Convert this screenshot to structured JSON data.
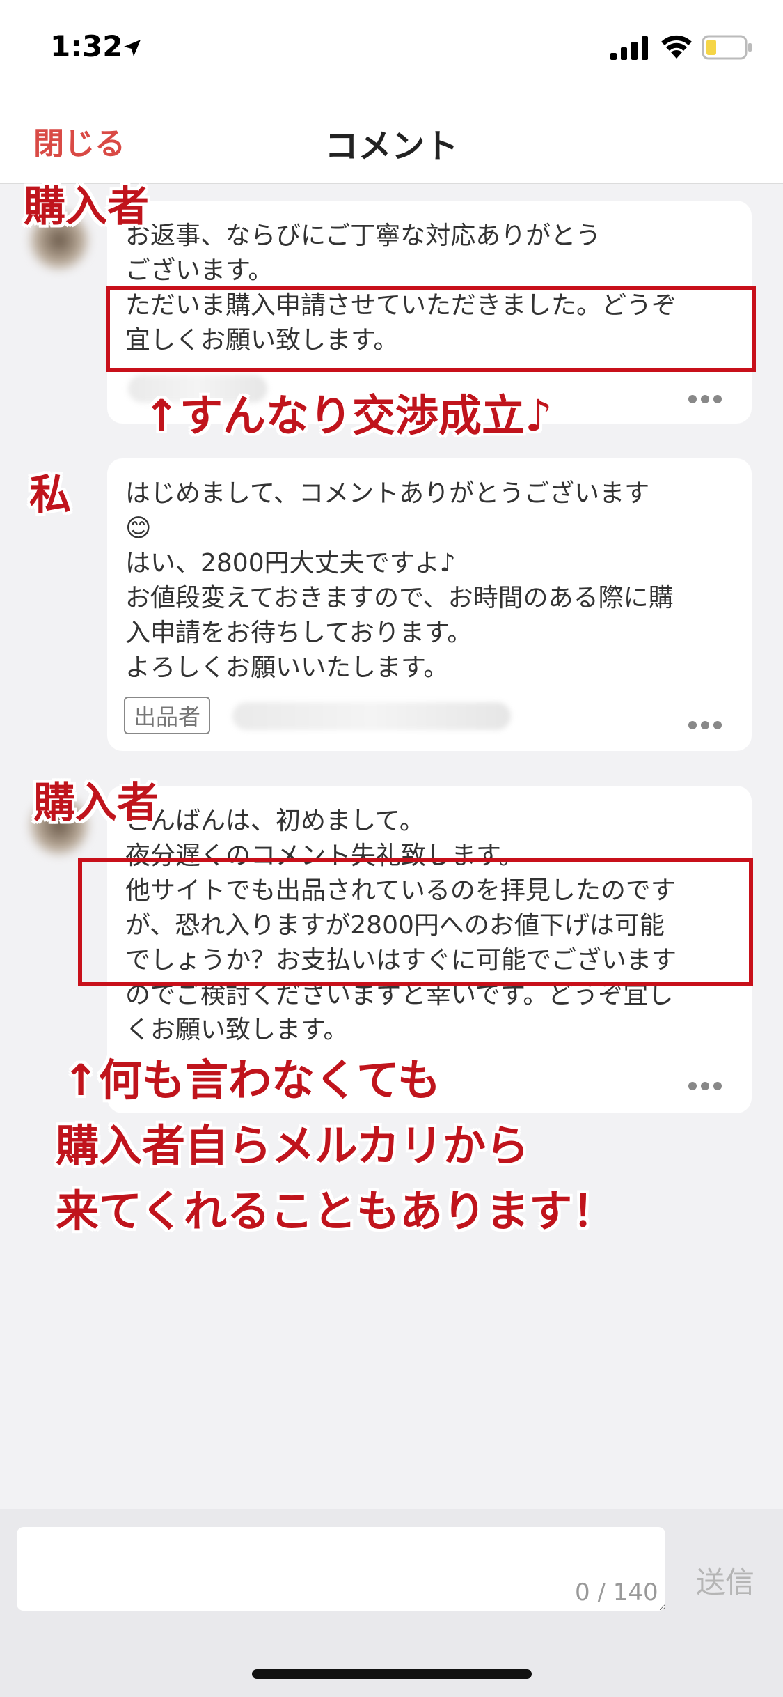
{
  "status_bar": {
    "time": "1:32"
  },
  "header": {
    "close_label": "閉じる",
    "title": "コメント"
  },
  "comments": [
    {
      "lines": [
        "お返事、ならびにご丁寧な対応ありがとう",
        "ございます。",
        "ただいま購入申請させていただきました。どうぞ",
        "宜しくお願い致します。"
      ]
    },
    {
      "lines": [
        "はじめまして、コメントありがとうございます",
        "😊",
        "はい、2800円大丈夫ですよ♪",
        "お値段変えておきますので、お時間のある際に購",
        "入申請をお待ちしております。",
        "よろしくお願いいたします。"
      ],
      "badge": "出品者"
    },
    {
      "lines": [
        "こんばんは、初めまして。",
        "夜分遅くのコメント失礼致します。",
        "他サイトでも出品されているのを拝見したのです",
        "が、恐れ入りますが2800円へのお値下げは可能",
        "でしょうか？お支払いはすぐに可能でございます",
        "のでご検討くださいますと幸いです。どうぞ宜し",
        "くお願い致します。"
      ]
    }
  ],
  "annotations": {
    "buyer_label_1": "購入者",
    "seller_label": "私",
    "buyer_label_2": "購入者",
    "note_1": "↑すんなり交渉成立♪",
    "note_2_line1": "↑何も言わなくても",
    "note_2_line2": "購入者自らメルカリから",
    "note_2_line3": "来てくれることもあります！"
  },
  "input": {
    "placeholder": "",
    "char_count": "0 / 140",
    "send_label": "送信"
  },
  "colors": {
    "accent": "#d94a45",
    "annotation_red": "#c0141c"
  }
}
